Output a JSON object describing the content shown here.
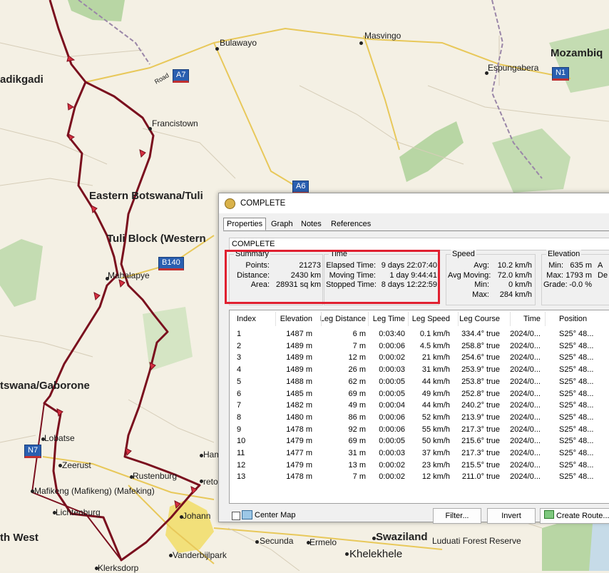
{
  "map": {
    "labels": [
      {
        "id": "kgalagadi",
        "text": "adikgadi",
        "cls": "region"
      },
      {
        "id": "bulawayo",
        "text": "Bulawayo",
        "cls": "city"
      },
      {
        "id": "masvingo",
        "text": "Masvingo",
        "cls": "city"
      },
      {
        "id": "mozambique",
        "text": "Mozambiq",
        "cls": "region"
      },
      {
        "id": "espungabera",
        "text": "Espungabera",
        "cls": "city"
      },
      {
        "id": "francistown",
        "text": "Francistown",
        "cls": "city"
      },
      {
        "id": "eastern-botswana",
        "text": "Eastern Botswana/Tuli",
        "cls": "region"
      },
      {
        "id": "tuli-block",
        "text": "Tuli Block (Western",
        "cls": "region"
      },
      {
        "id": "mahalapye",
        "text": "Mahalapye",
        "cls": "city"
      },
      {
        "id": "gaborone",
        "text": "tswana/Gaborone",
        "cls": "region"
      },
      {
        "id": "lobatse",
        "text": "Lobatse",
        "cls": "city"
      },
      {
        "id": "zeerust",
        "text": "Zeerust",
        "cls": "city"
      },
      {
        "id": "mafikeng",
        "text": "Mafikeng (Mafikeng) (Mafeking)",
        "cls": "city"
      },
      {
        "id": "rustenburg",
        "text": "Rustenburg",
        "cls": "city"
      },
      {
        "id": "lichtenburg",
        "text": "Lichtenburg",
        "cls": "city"
      },
      {
        "id": "north-west",
        "text": "th West",
        "cls": "region"
      },
      {
        "id": "johannesburg",
        "text": "Johann",
        "cls": "city"
      },
      {
        "id": "pretoria",
        "text": "reto",
        "cls": "city"
      },
      {
        "id": "ham",
        "text": "Ham",
        "cls": "city"
      },
      {
        "id": "secunda",
        "text": "Secunda",
        "cls": "city"
      },
      {
        "id": "ermelo",
        "text": "Ermelo",
        "cls": "city"
      },
      {
        "id": "swaziland",
        "text": "Swaziland",
        "cls": "region"
      },
      {
        "id": "luduati",
        "text": "Luduati Forest Reserve",
        "cls": "city"
      },
      {
        "id": "khelekhele",
        "text": "Khelekhele",
        "cls": "big"
      },
      {
        "id": "vanderbijlpark",
        "text": "Vanderbijlpark",
        "cls": "city"
      },
      {
        "id": "klerksdorp",
        "text": "Klerksdorp",
        "cls": "city"
      },
      {
        "id": "road",
        "text": "Road",
        "cls": "city"
      }
    ],
    "shields": [
      {
        "id": "a7",
        "text": "A7"
      },
      {
        "id": "n1",
        "text": "N1"
      },
      {
        "id": "a6",
        "text": "A6"
      },
      {
        "id": "b140",
        "text": "B140"
      },
      {
        "id": "n7",
        "text": "N7"
      }
    ]
  },
  "dialog": {
    "title": "COMPLETE",
    "tabs": [
      "Properties",
      "Graph",
      "Notes",
      "References"
    ],
    "name_value": "COMPLETE",
    "summary": {
      "title": "Summary",
      "rows": [
        {
          "k": "Points:",
          "v": "21273"
        },
        {
          "k": "Distance:",
          "v": "2430 km"
        },
        {
          "k": "Area:",
          "v": "28931 sq km"
        }
      ]
    },
    "time": {
      "title": "Time",
      "rows": [
        {
          "k": "Elapsed Time:",
          "v": "9 days 22:07:40"
        },
        {
          "k": "Moving Time:",
          "v": "1 day 9:44:41"
        },
        {
          "k": "Stopped Time:",
          "v": "8 days 12:22:59"
        }
      ]
    },
    "speed": {
      "title": "Speed",
      "rows": [
        {
          "k": "Avg:",
          "v": "10.2 km/h"
        },
        {
          "k": "Avg Moving:",
          "v": "72.0 km/h"
        },
        {
          "k": "Min:",
          "v": "0 km/h"
        },
        {
          "k": "Max:",
          "v": "284 km/h"
        }
      ]
    },
    "elevation": {
      "title": "Elevation",
      "rows": [
        {
          "k": "Min:",
          "v": "635 m",
          "x": "A"
        },
        {
          "k": "Max:",
          "v": "1793 m",
          "x": "De"
        },
        {
          "k": "Grade:",
          "v": "-0.0 %",
          "x": ""
        }
      ]
    },
    "columns": [
      "Index",
      "Elevation",
      "Leg Distance",
      "Leg Time",
      "Leg Speed",
      "Leg Course",
      "Time",
      "Position"
    ],
    "rows": [
      [
        "1",
        "1487 m",
        "6 m",
        "0:03:40",
        "0.1 km/h",
        "334.4° true",
        "2024/0...",
        "S25° 48..."
      ],
      [
        "2",
        "1489 m",
        "7 m",
        "0:00:06",
        "4.5 km/h",
        "258.8° true",
        "2024/0...",
        "S25° 48..."
      ],
      [
        "3",
        "1489 m",
        "12 m",
        "0:00:02",
        "21 km/h",
        "254.6° true",
        "2024/0...",
        "S25° 48..."
      ],
      [
        "4",
        "1489 m",
        "26 m",
        "0:00:03",
        "31 km/h",
        "253.9° true",
        "2024/0...",
        "S25° 48..."
      ],
      [
        "5",
        "1488 m",
        "62 m",
        "0:00:05",
        "44 km/h",
        "253.8° true",
        "2024/0...",
        "S25° 48..."
      ],
      [
        "6",
        "1485 m",
        "69 m",
        "0:00:05",
        "49 km/h",
        "252.8° true",
        "2024/0...",
        "S25° 48..."
      ],
      [
        "7",
        "1482 m",
        "49 m",
        "0:00:04",
        "44 km/h",
        "240.2° true",
        "2024/0...",
        "S25° 48..."
      ],
      [
        "8",
        "1480 m",
        "86 m",
        "0:00:06",
        "52 km/h",
        "213.9° true",
        "2024/0...",
        "S25° 48..."
      ],
      [
        "9",
        "1478 m",
        "92 m",
        "0:00:06",
        "55 km/h",
        "217.3° true",
        "2024/0...",
        "S25° 48..."
      ],
      [
        "10",
        "1479 m",
        "69 m",
        "0:00:05",
        "50 km/h",
        "215.6° true",
        "2024/0...",
        "S25° 48..."
      ],
      [
        "11",
        "1477 m",
        "31 m",
        "0:00:03",
        "37 km/h",
        "217.3° true",
        "2024/0...",
        "S25° 48..."
      ],
      [
        "12",
        "1479 m",
        "13 m",
        "0:00:02",
        "23 km/h",
        "215.5° true",
        "2024/0...",
        "S25° 48..."
      ],
      [
        "13",
        "1478 m",
        "7 m",
        "0:00:02",
        "12 km/h",
        "211.0° true",
        "2024/0...",
        "S25° 48..."
      ]
    ],
    "center_map_label": "Center Map",
    "filter_label": "Filter...",
    "invert_label": "Invert",
    "create_route_label": "Create Route..."
  },
  "colors": {
    "track": "#7a0f1e",
    "highlight": "#e02030",
    "water": "#c6dbe8",
    "green": "#b8d6a4"
  }
}
